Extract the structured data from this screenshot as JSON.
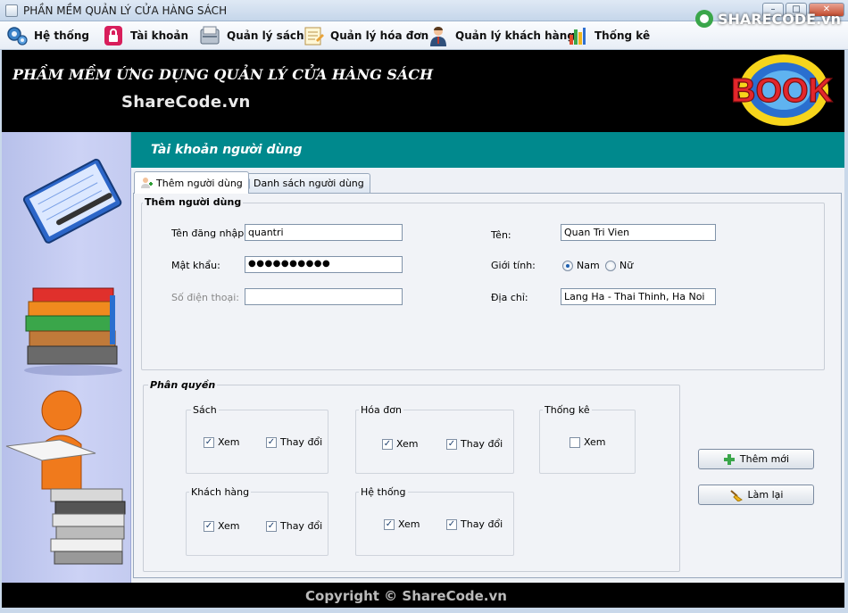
{
  "window": {
    "title": "PHẦN MỀM QUẢN LÝ CỬA HÀNG SÁCH"
  },
  "menu": [
    {
      "label": "Hệ thống",
      "icon": "gears-icon"
    },
    {
      "label": "Tài khoản",
      "icon": "lock-icon"
    },
    {
      "label": "Quản lý sách",
      "icon": "book-box-icon"
    },
    {
      "label": "Quản lý hóa đơn",
      "icon": "invoice-icon"
    },
    {
      "label": "Quản lý khách hàng",
      "icon": "customer-icon"
    },
    {
      "label": "Thống kê",
      "icon": "bar-chart-icon"
    }
  ],
  "header": {
    "heading": "PHẦM MỀM ỨNG DỤNG QUẢN LÝ CỬA HÀNG SÁCH",
    "watermark": "ShareCode.vn",
    "logo_text": "BOOK",
    "brand_logo": "SHARECODE.vn"
  },
  "panel": {
    "title": "Tài khoản người dùng"
  },
  "tabs": [
    {
      "label": "Thêm người dùng",
      "active": true
    },
    {
      "label": "Danh sách người dùng",
      "active": false
    }
  ],
  "user_form": {
    "group_title": "Thêm người dùng",
    "username_label": "Tên đăng nhập:",
    "username_value": "quantri",
    "password_label": "Mật khẩu:",
    "password_value": "●●●●●●●●●●",
    "phone_label": "Số điện thoại:",
    "phone_value": "",
    "name_label": "Tên:",
    "name_value": "Quan Tri Vien",
    "gender_label": "Giới tính:",
    "gender_male": "Nam",
    "gender_female": "Nữ",
    "gender_selected": "Nam",
    "address_label": "Địa chỉ:",
    "address_value": "Lang Ha - Thai Thinh, Ha Noi"
  },
  "permissions": {
    "group_title": "Phân quyền",
    "groups": [
      {
        "title": "Sách",
        "options": [
          {
            "label": "Xem",
            "checked": true
          },
          {
            "label": "Thay đổi",
            "checked": true
          }
        ]
      },
      {
        "title": "Hóa đơn",
        "options": [
          {
            "label": "Xem",
            "checked": true
          },
          {
            "label": "Thay đổi",
            "checked": true
          }
        ]
      },
      {
        "title": "Thống kê",
        "options": [
          {
            "label": "Xem",
            "checked": false
          }
        ]
      },
      {
        "title": "Khách hàng",
        "options": [
          {
            "label": "Xem",
            "checked": true
          },
          {
            "label": "Thay đổi",
            "checked": true
          }
        ]
      },
      {
        "title": "Hệ thống",
        "options": [
          {
            "label": "Xem",
            "checked": true
          },
          {
            "label": "Thay đổi",
            "checked": true
          }
        ]
      }
    ]
  },
  "buttons": {
    "add": "Thêm mới",
    "reset": "Làm lại"
  },
  "footer": {
    "copyright": "Copyright © ShareCode.vn"
  },
  "colors": {
    "panel_header": "#00898d",
    "header_bg": "#000000",
    "logo_red": "#e3262b",
    "logo_yellow": "#f7d51b",
    "logo_blue": "#2a6fcf"
  }
}
